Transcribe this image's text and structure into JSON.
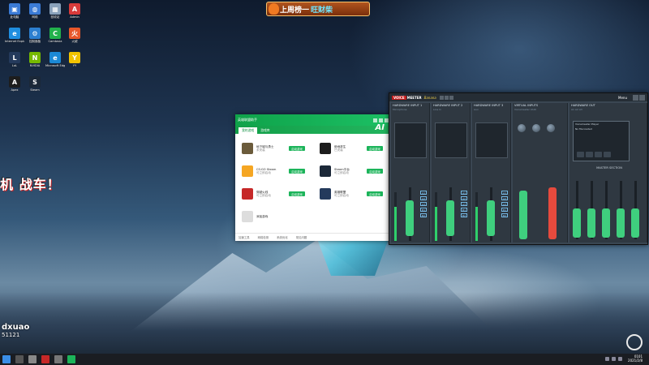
{
  "banner": {
    "text": "上周榜一",
    "highlight": "旺财柴"
  },
  "overlay": {
    "text": "机 战车！",
    "streamer_name": "dxuao",
    "streamer_id": "51121"
  },
  "desktop_icons": [
    {
      "label": "此电脑",
      "color": "#3b7bd6",
      "glyph": "▣"
    },
    {
      "label": "网络",
      "color": "#3b7bd6",
      "glyph": "◍"
    },
    {
      "label": "回收站",
      "color": "#8aa2bb",
      "glyph": "▦"
    },
    {
      "label": "Admin",
      "color": "#d83b3b",
      "glyph": "A"
    },
    {
      "label": "Internet Explorer",
      "color": "#1f8ee0",
      "glyph": "e"
    },
    {
      "label": "控制面板",
      "color": "#2c7fd0",
      "glyph": "⚙"
    },
    {
      "label": "Camtasia",
      "color": "#22b14c",
      "glyph": "C"
    },
    {
      "label": "火绒",
      "color": "#e8572a",
      "glyph": "火"
    },
    {
      "label": "LoL",
      "color": "#243a5c",
      "glyph": "L"
    },
    {
      "label": "NVIDIA",
      "color": "#76b900",
      "glyph": "N"
    },
    {
      "label": "Microsoft Edge",
      "color": "#1b89d6",
      "glyph": "e"
    },
    {
      "label": "YY",
      "color": "#f2c300",
      "glyph": "Y"
    },
    {
      "label": "Apex",
      "color": "#1d1d1d",
      "glyph": "A"
    },
    {
      "label": "Steam",
      "color": "#1b2838",
      "glyph": "S"
    }
  ],
  "green_window": {
    "title": "英雄联盟助手",
    "brand": "AI",
    "tabs": [
      "我的游戏",
      "游戏库"
    ],
    "items": [
      {
        "name": "地下城与勇士",
        "sub": "未安装",
        "button": "启动游戏",
        "logo_color": "#6b5b3b"
      },
      {
        "name": "绝地求生",
        "sub": "已安装",
        "button": "启动游戏",
        "logo_color": "#1d1d1d"
      },
      {
        "name": "CS:GO Steam",
        "sub": "可立即启动",
        "button": "启动游戏",
        "logo_color": "#f5a623"
      },
      {
        "name": "Steam平台",
        "sub": "可立即启动",
        "button": "启动游戏",
        "logo_color": "#1b2838"
      },
      {
        "name": "穿越火线",
        "sub": "可立即启动",
        "button": "启动游戏",
        "logo_color": "#c62828"
      },
      {
        "name": "英雄联盟",
        "sub": "可立即启动",
        "button": "启动游戏",
        "logo_color": "#243a5c"
      },
      {
        "name": "添加游戏",
        "sub": "",
        "button": "启动游戏",
        "logo_color": "#dddddd"
      }
    ],
    "footer": [
      "加速工具",
      "网络检测",
      "系统优化",
      "常见问题"
    ]
  },
  "voicemeeter": {
    "badge": "VOICE",
    "name": "MEETER",
    "edition": "Banana",
    "menu": "Menu",
    "strips": [
      {
        "title": "HARDWARE INPUT 1",
        "sub": "Microphone"
      },
      {
        "title": "HARDWARE INPUT 2",
        "sub": "Line In"
      },
      {
        "title": "HARDWARE INPUT 3",
        "sub": "Aux"
      },
      {
        "title": "VIRTUAL INPUTS",
        "sub": "Voicemeeter VAIO"
      },
      {
        "title": "HARDWARE OUT",
        "sub": "A1 A2 A3"
      }
    ],
    "bus_buttons": [
      "A1",
      "A2",
      "A3",
      "B1",
      "B2"
    ],
    "player": {
      "line1": "Voicemeeter Player",
      "line2": "No file loaded"
    },
    "master_label": "MASTER SECTION"
  },
  "taskbar": {
    "time": "0101",
    "date": "2021/2/8"
  }
}
